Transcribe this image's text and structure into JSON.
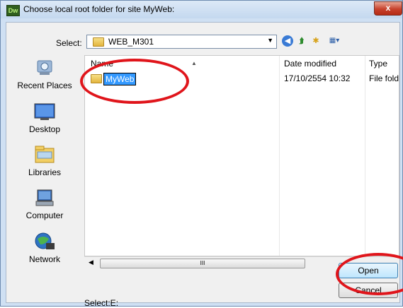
{
  "window": {
    "app_badge": "Dw",
    "title": "Choose local root folder for site MyWeb:",
    "close_label": "x"
  },
  "toolbar": {
    "select_label": "Select:",
    "current_folder": "WEB_M301"
  },
  "places": [
    {
      "label": "Recent Places",
      "icon": "recent-places-icon"
    },
    {
      "label": "Desktop",
      "icon": "desktop-icon"
    },
    {
      "label": "Libraries",
      "icon": "libraries-icon"
    },
    {
      "label": "Computer",
      "icon": "computer-icon"
    },
    {
      "label": "Network",
      "icon": "network-icon"
    }
  ],
  "file_list": {
    "columns": [
      "Name",
      "Date modified",
      "Type"
    ],
    "rows": [
      {
        "name": "MyWeb",
        "date_modified": "17/10/2554 10:32",
        "type": "File folder"
      }
    ]
  },
  "scrollbar": {
    "thumb_grip": "III"
  },
  "footer": {
    "status": "Select:E:",
    "open_label": "Open",
    "cancel_label": "Cancel"
  },
  "colors": {
    "selection": "#3399ff",
    "annotation": "#e0151b",
    "frame": "#cfe0f3"
  }
}
